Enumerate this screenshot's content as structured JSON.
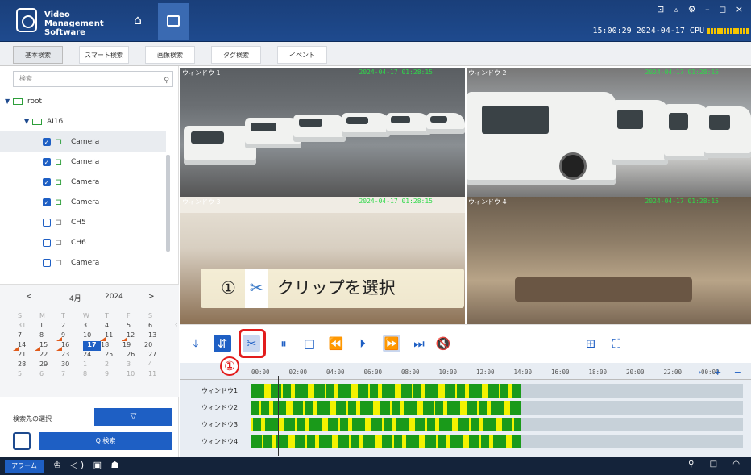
{
  "header": {
    "app_title": "Video Management Software",
    "window_controls": "⊡ ⍓ ⚙ – ◻ ×",
    "clock": "15:00:29 2024-04-17 CPU",
    "icons": {
      "home": "home-icon",
      "camera": "camera-icon"
    }
  },
  "tabs": [
    "基本検索",
    "スマート検索",
    "画像検索",
    "タグ検索",
    "イベント"
  ],
  "sidebar": {
    "search_placeholder": "検索",
    "tree": [
      {
        "label": "root",
        "type": "folder"
      },
      {
        "label": "AI16",
        "type": "folder"
      },
      {
        "label": "Camera",
        "checked": true,
        "online": true
      },
      {
        "label": "Camera",
        "checked": true,
        "online": true
      },
      {
        "label": "Camera",
        "checked": true,
        "online": true
      },
      {
        "label": "Camera",
        "checked": true,
        "online": true
      },
      {
        "label": "CH5",
        "checked": false,
        "online": false
      },
      {
        "label": "CH6",
        "checked": false,
        "online": false
      },
      {
        "label": "Camera",
        "checked": false,
        "online": false
      }
    ],
    "calendar": {
      "month": "4月",
      "year": "2024",
      "weekdays": [
        "S",
        "M",
        "T",
        "W",
        "T",
        "F",
        "S"
      ],
      "weeks": [
        [
          "31",
          "1",
          "2",
          "3",
          "4",
          "5",
          "6"
        ],
        [
          "7",
          "8",
          "9",
          "10",
          "11",
          "12",
          "13"
        ],
        [
          "14",
          "15",
          "16",
          "17",
          "18",
          "19",
          "20"
        ],
        [
          "21",
          "22",
          "23",
          "24",
          "25",
          "26",
          "27"
        ],
        [
          "28",
          "29",
          "30",
          "1",
          "2",
          "3",
          "4"
        ],
        [
          "5",
          "6",
          "7",
          "8",
          "9",
          "10",
          "11"
        ]
      ],
      "today": "17",
      "recorded_days": [
        "9",
        "11",
        "12",
        "14",
        "15",
        "16"
      ]
    },
    "dest_label": "検索先の選択",
    "filter_icon": "▽",
    "search_button": "Q 検索"
  },
  "videos": [
    {
      "label": "ウィンドウ 1",
      "timestamp": "2024-04-17 01:28:15"
    },
    {
      "label": "ウィンドウ 2",
      "timestamp": "2024-04-17 01:28:15"
    },
    {
      "label": "ウィンドウ 3",
      "timestamp": "2024-04-17 01:28:15"
    },
    {
      "label": "ウィンドウ 4",
      "timestamp": "2024-04-17 01:28:15"
    }
  ],
  "callout": {
    "number": "①",
    "text": "クリップを選択"
  },
  "annotation_marker": "①",
  "toolbar_icons": [
    "download-icon",
    "sync-icon",
    "clip-icon",
    "pause-icon",
    "stop-icon",
    "rewind-icon",
    "step-forward-icon",
    "fast-forward-icon",
    "frame-step-icon",
    "mute-icon",
    "layout-icon",
    "fullscreen-icon"
  ],
  "timeline": {
    "ticks": [
      "00:00",
      "02:00",
      "04:00",
      "06:00",
      "08:00",
      "10:00",
      "12:00",
      "14:00",
      "16:00",
      "18:00",
      "20:00",
      "22:00",
      "00:00"
    ],
    "zoom_controls": "› + −",
    "tracks": [
      "ウィンドウ1",
      "ウィンドウ2",
      "ウィンドウ3",
      "ウィンドウ4"
    ]
  },
  "taskbar": {
    "alarm": "アラーム",
    "icons": "♔ ◁) ▣ ☗",
    "right": "⚲ □ ◠"
  },
  "colors": {
    "accent": "#1e5fc4",
    "header": "#1e4a8e",
    "highlight": "#e21c1c",
    "rec_green": "#1a9a1a",
    "rec_yellow": "#f2f200"
  }
}
